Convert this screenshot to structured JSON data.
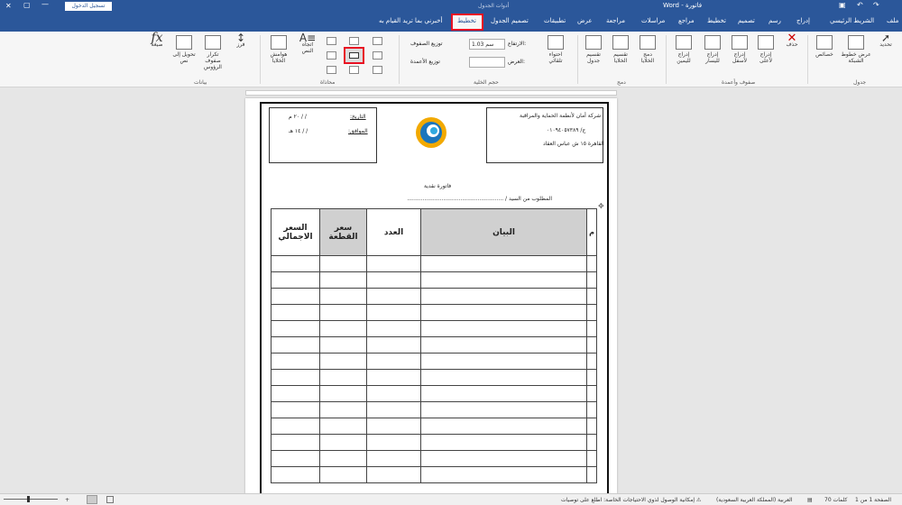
{
  "titlebar": {
    "doc_title": "فاتورة - Word",
    "context_label": "أدوات الجدول",
    "signin": "تسجيل الدخول"
  },
  "tabs": [
    "ملف",
    "الشريط الرئيسي",
    "إدراج",
    "رسم",
    "تصميم",
    "تخطيط",
    "مراجع",
    "مراسلات",
    "مراجعة",
    "عرض",
    "تطبيقات",
    "تصميم الجدول",
    "تخطيط"
  ],
  "tellme": "أخبرني بما تريد القيام به",
  "ribbon": {
    "table_group": {
      "label": "جدول",
      "select": "تحديد",
      "gridlines": "عرض خطوط الشبكة",
      "properties": "خصائص"
    },
    "rowscols_group": {
      "label": "صفوف وأعمدة",
      "delete": "حذف",
      "insert_above": "إدراج لأعلى",
      "insert_below": "إدراج لأسفل",
      "insert_left": "إدراج لليسار",
      "insert_right": "إدراج لليمين"
    },
    "merge_group": {
      "label": "دمج",
      "merge": "دمج الخلايا",
      "split": "تقسيم الخلايا",
      "split_table": "تقسيم جدول"
    },
    "cellsize_group": {
      "label": "حجم الخلية",
      "autofit": "احتواء تلقائي",
      "height_label": "الارتفاع:",
      "height_value": "1.03 سم",
      "width_label": "العرض:",
      "dist_rows": "توزيع الصفوف",
      "dist_cols": "توزيع الأعمدة"
    },
    "align_group": {
      "label": "محاذاة",
      "text_dir": "اتجاه النص",
      "margins": "هوامش الخلايا"
    },
    "data_group": {
      "label": "بيانات",
      "sort": "فرز",
      "repeat": "تكرار صفوف الرؤوس",
      "convert": "تحويل إلى نص",
      "formula": "صيغة",
      "fx": "fx"
    }
  },
  "doc": {
    "company": "شركة أمان لأنظمة الحماية والمراقبة",
    "phone": "ج/ ٠١٠٩٤٠٥٧٣٨٩",
    "address": "القاهرة ١٥ ش عباس العقاد",
    "date_label": "التاريخ:",
    "date_value": "/ / ٢٠ م",
    "hijri_label": "الموافق:",
    "hijri_value": "/ / ١٤ هـ",
    "invoice_title": "فاتورة نقدية",
    "required_from": "المطلوب من السيد / ........................................................",
    "headers": [
      "م",
      "البيان",
      "العدد",
      "سعر القطعة",
      "السعر الاجمالي"
    ]
  },
  "status": {
    "page": "الصفحة 1 من 1",
    "words": "70 كلمات",
    "language": "العربية (المملكة العربية السعودية)",
    "accessibility": "إمكانية الوصول لذوي الاحتياجات الخاصة: اطلع على توصيات"
  },
  "colors": {
    "accent": "#2b579a",
    "highlight": "#e81123"
  }
}
